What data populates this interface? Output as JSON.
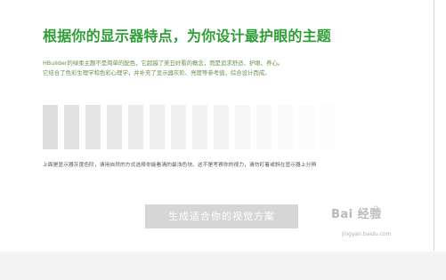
{
  "header": {
    "title": "根据你的显示器特点，为你设计最护眼的主题"
  },
  "description": {
    "line1": "HBuilder的绿柔主题不是简单的配色，它超越了美丑好看的概念，而是追求舒适、护眼、养心。",
    "line2": "它结合了色彩生理学和色彩心理学，并补充了显示器灰阶、亮度等参考值，综合设计而成。"
  },
  "swatches": {
    "colors": [
      "#dedede",
      "#e2e2e2",
      "#e5e5e5",
      "#e8e8e8",
      "#ebebeb",
      "#eeeeee",
      "#f0f0f0",
      "#f2f2f2",
      "#f4f4f4",
      "#f6f6f6",
      "#f8f8f8",
      "#fafafa",
      "#fbfbfb",
      "#fdfdfd"
    ]
  },
  "note": "上面是显示器灰度色阶，请用自然的方式选择你能看清的最浅色块。这不是考察你的视力，请勿盯着或斜在显示器上分辨",
  "cta": {
    "label": "生成适合你的视觉方案"
  },
  "watermark": {
    "logo": "Bai 经验",
    "url": "jingyan.baidu.com"
  },
  "theme": {
    "accent": "#2f9e36",
    "button_bg": "#d6d6d6"
  }
}
